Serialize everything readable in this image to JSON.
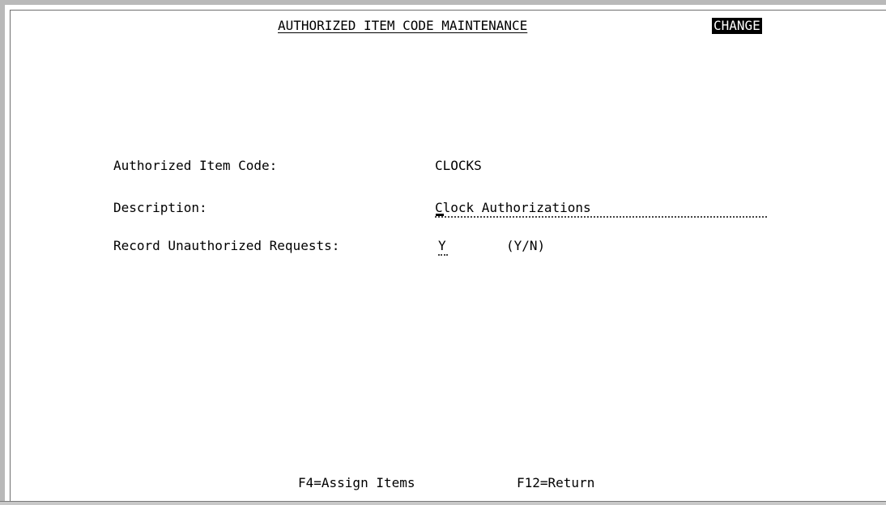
{
  "screen": {
    "title": "AUTHORIZED ITEM CODE MAINTENANCE",
    "mode": "CHANGE"
  },
  "fields": {
    "item_code_label": "Authorized Item Code:",
    "item_code_value": "CLOCKS",
    "description_label": "Description:",
    "description_value": "Clock Authorizations",
    "record_unauth_label": "Record Unauthorized Requests:",
    "record_unauth_value": "Y",
    "record_unauth_hint": "(Y/N)"
  },
  "function_keys": [
    {
      "label": "F4=Assign Items"
    },
    {
      "label": "F12=Return"
    }
  ]
}
